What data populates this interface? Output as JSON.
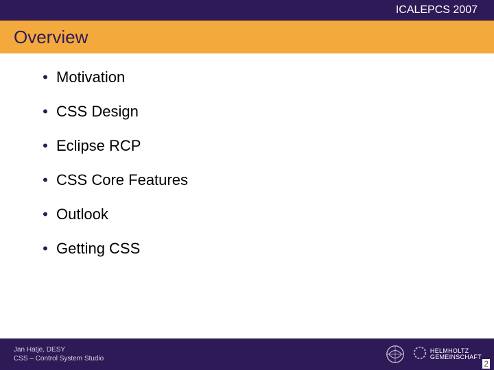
{
  "header": {
    "conference": "ICALEPCS 2007"
  },
  "title": "Overview",
  "bullets": [
    "Motivation",
    "CSS Design",
    "Eclipse RCP",
    "CSS Core Features",
    "Outlook",
    "Getting CSS"
  ],
  "footer": {
    "line1": "Jan Hatje, DESY",
    "line2": "CSS – Control System Studio",
    "helmholtz_line1": "HELMHOLTZ",
    "helmholtz_line2": "GEMEINSCHAFT"
  },
  "page_number": "2"
}
